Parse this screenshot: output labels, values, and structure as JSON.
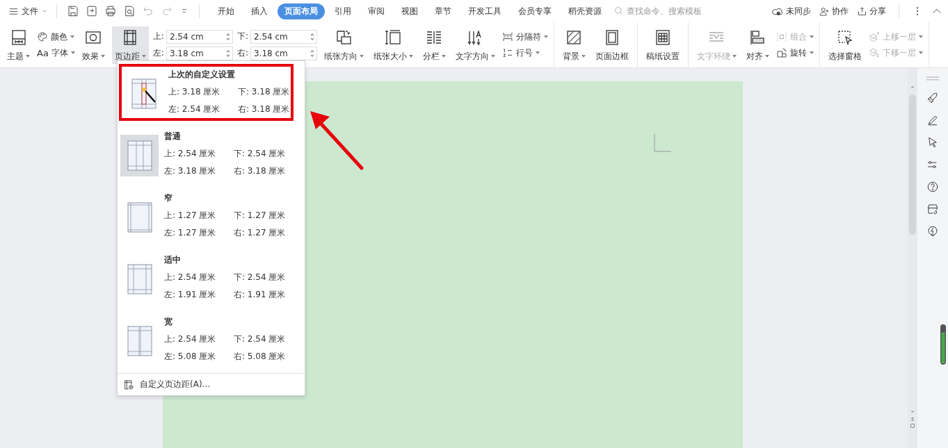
{
  "menu_bar": {
    "file_menu": "文件",
    "tabs": [
      {
        "label": "开始",
        "selected": false
      },
      {
        "label": "插入",
        "selected": false
      },
      {
        "label": "页面布局",
        "selected": true
      },
      {
        "label": "引用",
        "selected": false
      },
      {
        "label": "审阅",
        "selected": false
      },
      {
        "label": "视图",
        "selected": false
      },
      {
        "label": "章节",
        "selected": false
      },
      {
        "label": "开发工具",
        "selected": false
      },
      {
        "label": "会员专享",
        "selected": false
      },
      {
        "label": "稻壳资源",
        "selected": false
      }
    ],
    "search": {
      "placeholder": "查找命令、搜索模板"
    },
    "actions": [
      "未同步",
      "协作",
      "分享"
    ]
  },
  "ribbon": {
    "groups": [
      [
        {
          "kind": "big",
          "label": "主题",
          "dropdown": true,
          "pressed": false,
          "disabled": false
        },
        {
          "kind": "pair",
          "items": [
            {
              "label": "颜色",
              "dropdown": true,
              "disabled": false
            },
            {
              "glyph": "Aa",
              "label": "字体",
              "dropdown": true,
              "disabled": false
            }
          ]
        },
        {
          "kind": "big",
          "label": "效果",
          "dropdown": true,
          "pressed": false,
          "disabled": false
        },
        {
          "kind": "big",
          "label": "页边距",
          "dropdown": true,
          "pressed": true,
          "disabled": false
        },
        {
          "kind": "margins",
          "fields": [
            {
              "label": "上:",
              "value": "2.54 cm"
            },
            {
              "label": "下:",
              "value": "2.54 cm"
            },
            {
              "label": "左:",
              "value": "3.18 cm"
            },
            {
              "label": "右:",
              "value": "3.18 cm"
            }
          ]
        },
        {
          "kind": "big",
          "label": "纸张方向",
          "dropdown": true,
          "pressed": false,
          "disabled": false
        },
        {
          "kind": "big",
          "label": "纸张大小",
          "dropdown": true,
          "pressed": false,
          "disabled": false
        },
        {
          "kind": "big",
          "label": "分栏",
          "dropdown": true,
          "pressed": false,
          "disabled": false
        },
        {
          "kind": "big",
          "label": "文字方向",
          "dropdown": true,
          "pressed": false,
          "disabled": false
        },
        {
          "kind": "pair",
          "items": [
            {
              "label": "分隔符",
              "dropdown": true,
              "disabled": false
            },
            {
              "label": "行号",
              "dropdown": true,
              "disabled": false
            }
          ]
        }
      ],
      [
        {
          "kind": "big",
          "label": "背景",
          "dropdown": true,
          "pressed": false,
          "disabled": false
        },
        {
          "kind": "big",
          "label": "页面边框",
          "dropdown": false,
          "pressed": false,
          "disabled": false
        }
      ],
      [
        {
          "kind": "big",
          "label": "稿纸设置",
          "dropdown": false,
          "pressed": false,
          "disabled": false
        }
      ],
      [
        {
          "kind": "big",
          "label": "文字环绕",
          "dropdown": true,
          "pressed": false,
          "disabled": true
        },
        {
          "kind": "big",
          "label": "对齐",
          "dropdown": true,
          "pressed": false,
          "disabled": false
        },
        {
          "kind": "pair",
          "items": [
            {
              "label": "组合",
              "dropdown": true,
              "disabled": true
            },
            {
              "label": "旋转",
              "dropdown": true,
              "disabled": false
            }
          ]
        }
      ],
      [
        {
          "kind": "big",
          "label": "选择窗格",
          "dropdown": false,
          "pressed": false,
          "disabled": false
        },
        {
          "kind": "pair",
          "items": [
            {
              "label": "上移一层",
              "dropdown": true,
              "disabled": true
            },
            {
              "label": "下移一层",
              "dropdown": true,
              "disabled": true
            }
          ]
        }
      ]
    ]
  },
  "margin_menu": {
    "items": [
      {
        "title": "上次的自定义设置",
        "top": "上: 3.18 厘米",
        "bottom": "下: 3.18 厘米",
        "left": "左: 2.54 厘米",
        "right": "右: 3.18 厘米",
        "selected": false,
        "highlighted": true
      },
      {
        "title": "普通",
        "top": "上: 2.54 厘米",
        "bottom": "下: 2.54 厘米",
        "left": "左: 3.18 厘米",
        "right": "右: 3.18 厘米",
        "selected": true,
        "highlighted": false
      },
      {
        "title": "窄",
        "top": "上: 1.27 厘米",
        "bottom": "下: 1.27 厘米",
        "left": "左: 1.27 厘米",
        "right": "右: 1.27 厘米",
        "selected": false,
        "highlighted": false
      },
      {
        "title": "适中",
        "top": "上: 2.54 厘米",
        "bottom": "下: 2.54 厘米",
        "left": "左: 1.91 厘米",
        "right": "右: 1.91 厘米",
        "selected": false,
        "highlighted": false
      },
      {
        "title": "宽",
        "top": "上: 2.54 厘米",
        "bottom": "下: 2.54 厘米",
        "left": "左: 5.08 厘米",
        "right": "右: 5.08 厘米",
        "selected": false,
        "highlighted": false
      }
    ],
    "footer": "自定义页边距(A)..."
  }
}
